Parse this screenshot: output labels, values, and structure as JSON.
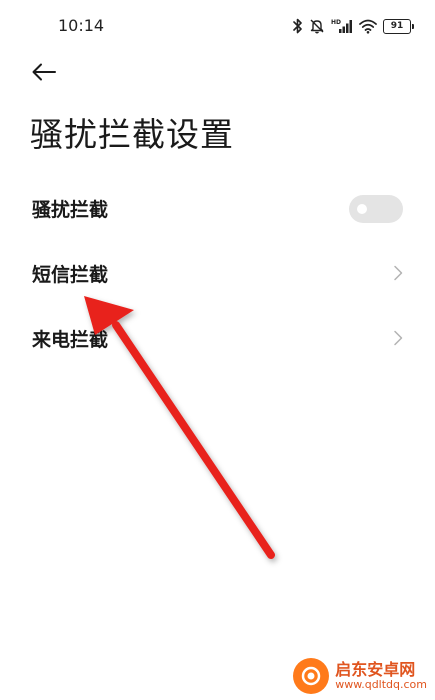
{
  "status_bar": {
    "time": "10:14",
    "battery_level": "91",
    "network_label": "HD"
  },
  "header": {
    "back_icon": "arrow-left-icon",
    "title": "骚扰拦截设置"
  },
  "settings": [
    {
      "label": "骚扰拦截",
      "control": "toggle",
      "enabled": false
    },
    {
      "label": "短信拦截",
      "control": "chevron"
    },
    {
      "label": "来电拦截",
      "control": "chevron"
    }
  ],
  "annotation": {
    "arrow_color": "#e8231f"
  },
  "watermark": {
    "name": "启东安卓网",
    "url": "www.qdltdq.com",
    "color": "#e0551f"
  }
}
